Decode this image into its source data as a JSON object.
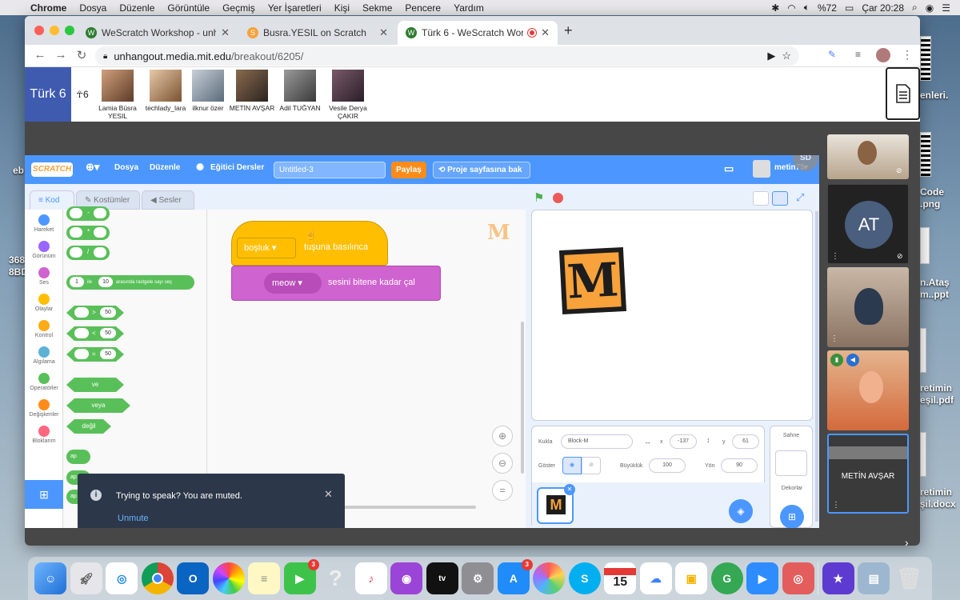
{
  "menubar": {
    "app": "Chrome",
    "items": [
      "Dosya",
      "Düzenle",
      "Görüntüle",
      "Geçmiş",
      "Yer İşaretleri",
      "Kişi",
      "Sekme",
      "Pencere",
      "Yardım"
    ],
    "battery": "%72",
    "clock": "Çar 20:28"
  },
  "desktop": {
    "labels": [
      "enleri.",
      "eb",
      "Code",
      ".png",
      "368",
      "8BD",
      "n.Ataş",
      "m..ppt",
      "retimin",
      "eşil.pdf",
      "retimin",
      "şil.docx"
    ]
  },
  "browser": {
    "tabs": [
      {
        "title": "WeScratch Workshop - unhango"
      },
      {
        "title": "Busra.YESIL on Scratch"
      },
      {
        "title": "Türk 6 - WeScratch Worksho"
      }
    ],
    "url_host": "unhangout.media.mit.edu",
    "url_path": "/breakout/6205/"
  },
  "unhangout": {
    "room": "Türk 6",
    "count": "6",
    "participants": [
      {
        "name": "Lamia Büsra YESIL"
      },
      {
        "name": "techlady_lara"
      },
      {
        "name": "ilknur özer"
      },
      {
        "name": "METİN AVŞAR"
      },
      {
        "name": "Adil TUĞYAN"
      },
      {
        "name": "Vesile Derya ÇAKIR"
      }
    ]
  },
  "scratch": {
    "logo": "SCRATCH",
    "menu": {
      "file": "Dosya",
      "edit": "Düzenle",
      "tutorials": "Eğitici Dersler",
      "title": "Untitled-3",
      "share": "Paylaş",
      "see_project": "Proje sayfasına bak",
      "user": "metin75"
    },
    "tabs": {
      "code": "Kod",
      "costumes": "Kostümler",
      "sounds": "Sesler"
    },
    "categories": [
      {
        "label": "Hareket",
        "color": "#4c97ff"
      },
      {
        "label": "Görünüm",
        "color": "#9966ff"
      },
      {
        "label": "Ses",
        "color": "#cf63cf"
      },
      {
        "label": "Olaylar",
        "color": "#ffbf00"
      },
      {
        "label": "Kontrol",
        "color": "#ffab19"
      },
      {
        "label": "Algılama",
        "color": "#5cb1d6"
      },
      {
        "label": "Operatörler",
        "color": "#59c059"
      },
      {
        "label": "Değişkenler",
        "color": "#ff8c1a"
      },
      {
        "label": "Bloklarım",
        "color": "#ff6680"
      }
    ],
    "palette": {
      "ops": [
        "-",
        "*",
        "/"
      ],
      "random": {
        "from": "1",
        "between": "ile",
        "to": "10",
        "label": "arasında rastgele sayı seç"
      },
      "compare": [
        {
          "op": ">",
          "val": "50"
        },
        {
          "op": "<",
          "val": "50"
        },
        {
          "op": "=",
          "val": "50"
        }
      ],
      "logic": [
        "ve",
        "veya",
        "değil"
      ],
      "partial": [
        "ap",
        "ap",
        "ap"
      ]
    },
    "script": {
      "hat_key": "boşluk",
      "hat_label": "tuşuna basılınca",
      "sound_name": "meow",
      "sound_label": "sesini bitene kadar çal"
    },
    "sprite": {
      "label_sprite": "Kukla",
      "name": "Block-M",
      "label_x": "x",
      "x": "-137",
      "label_y": "y",
      "y": "61",
      "label_show": "Göster",
      "label_size": "Büyüklük",
      "size": "100",
      "label_direction": "Yön",
      "direction": "90"
    },
    "stage_pane": {
      "title": "Sahne",
      "backdrops": "Dekorlar"
    },
    "sd": "SD"
  },
  "toast": {
    "message": "Trying to speak? You are muted.",
    "action": "Unmute"
  },
  "filmstrip": {
    "at_initials": "AT",
    "metin_label": "METİN AVŞAR"
  },
  "dock": {
    "calendar_day": "15",
    "badges": {
      "facetime": "3",
      "appstore": "3"
    }
  }
}
